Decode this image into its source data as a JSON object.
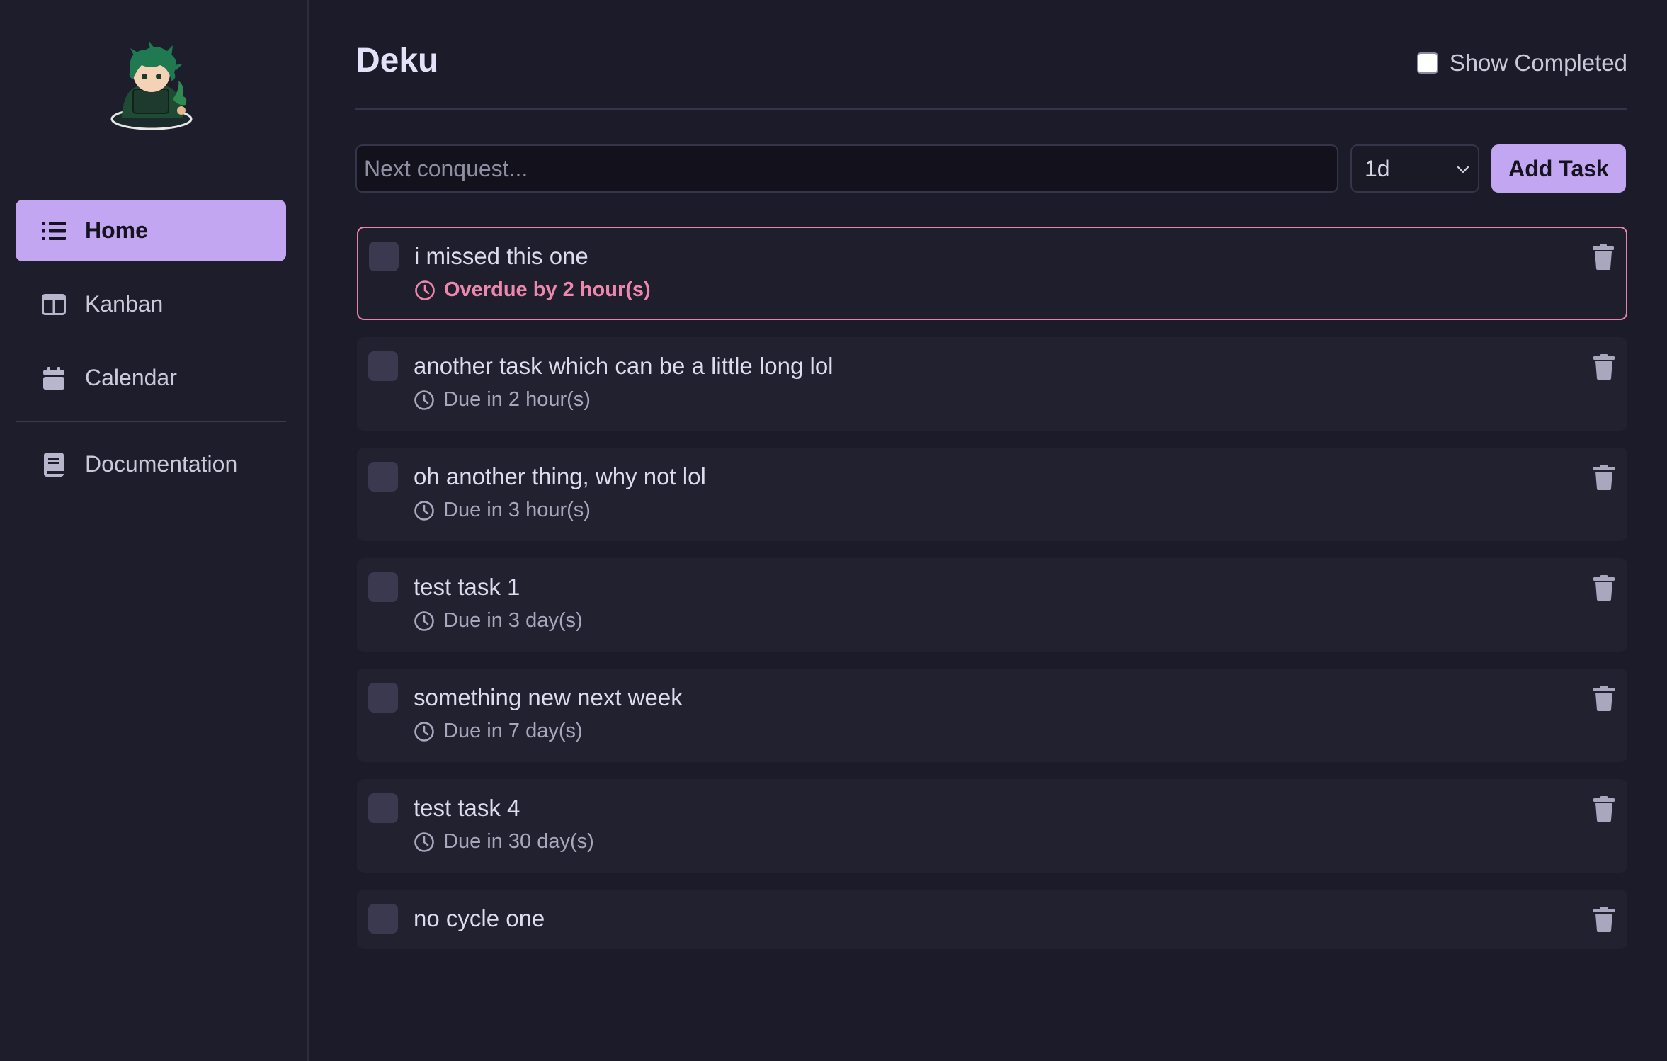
{
  "sidebar": {
    "logo_name": "deku-chibi-logo",
    "items": [
      {
        "label": "Home",
        "icon": "list-icon",
        "active": true
      },
      {
        "label": "Kanban",
        "icon": "columns-icon",
        "active": false
      },
      {
        "label": "Calendar",
        "icon": "calendar-icon",
        "active": false
      },
      {
        "label": "Documentation",
        "icon": "book-icon",
        "active": false
      }
    ]
  },
  "header": {
    "title": "Deku",
    "show_completed_label": "Show Completed",
    "show_completed_checked": false
  },
  "new_task": {
    "placeholder": "Next conquest...",
    "value": "",
    "cycle_value": "1d",
    "add_label": "Add Task"
  },
  "tasks": [
    {
      "title": "i missed this one",
      "meta": "Overdue by 2 hour(s)",
      "status": "overdue"
    },
    {
      "title": "another task which can be a little long lol",
      "meta": "Due in 2 hour(s)",
      "status": "due"
    },
    {
      "title": "oh another thing, why not lol",
      "meta": "Due in 3 hour(s)",
      "status": "due"
    },
    {
      "title": "test task 1",
      "meta": "Due in 3 day(s)",
      "status": "due"
    },
    {
      "title": "something new next week",
      "meta": "Due in 7 day(s)",
      "status": "due"
    },
    {
      "title": "test task 4",
      "meta": "Due in 30 day(s)",
      "status": "due"
    },
    {
      "title": "no cycle one",
      "meta": "",
      "status": "none"
    }
  ],
  "colors": {
    "accent": "#c3a6f1",
    "overdue": "#e884a8",
    "background": "#1c1b29",
    "sidebar": "#1e1d2c",
    "card": "#222130"
  }
}
